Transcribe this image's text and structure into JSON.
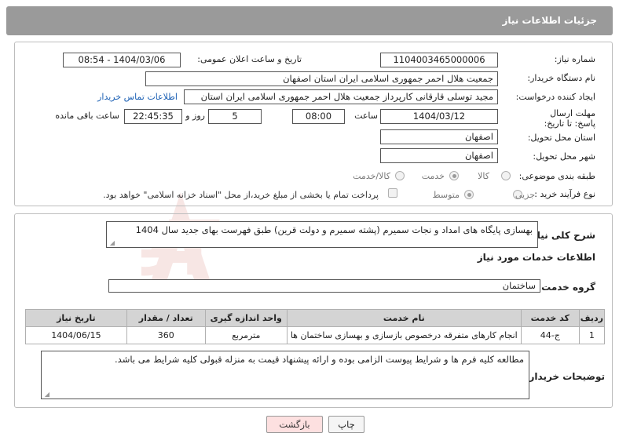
{
  "header": {
    "title": "جزئیات اطلاعات نیاز"
  },
  "fields": {
    "need_number_label": "شماره نیاز:",
    "need_number": "1104003465000006",
    "announce_label": "تاریخ و ساعت اعلان عمومی:",
    "announce_value": "1404/03/06 - 08:54",
    "buyer_org_label": "نام دستگاه خریدار:",
    "buyer_org": "جمعیت هلال احمر جمهوری اسلامی ایران استان اصفهان",
    "creator_label": "ایجاد کننده درخواست:",
    "creator": "مجید توسلی قارقانی کارپرداز جمعیت هلال احمر جمهوری اسلامی ایران استان",
    "contact_link": "اطلاعات تماس خریدار",
    "deadline_label": "مهلت ارسال پاسخ: تا تاریخ:",
    "deadline_date": "1404/03/12",
    "time_label": "ساعت",
    "deadline_time": "08:00",
    "days_value": "5",
    "days_label": "روز و",
    "remaining_time": "22:45:35",
    "remaining_label": "ساعت باقی مانده",
    "province_label": "استان محل تحویل:",
    "province": "اصفهان",
    "city_label": "شهر محل تحویل:",
    "city": "اصفهان",
    "category_label": "طبقه بندی موضوعی:",
    "category_options": [
      "کالا",
      "خدمت",
      "کالا/خدمت"
    ],
    "category_selected": "خدمت",
    "process_label": "نوع فرآیند خرید :",
    "process_options": [
      "جزیی",
      "متوسط"
    ],
    "process_selected": "متوسط",
    "treasury_text": "پرداخت تمام یا بخشی از مبلغ خرید،از محل \"اسناد خزانه اسلامی\" خواهد بود."
  },
  "description": {
    "label": "شرح کلی نیاز:",
    "value": "بهسازی پایگاه های امداد و نجات سمیرم (پشته سمیرم و دولت قرین) طبق فهرست بهای جدید سال 1404"
  },
  "services": {
    "section_title": "اطلاعات خدمات مورد نیاز",
    "group_label": "گروه خدمت:",
    "group_value": "ساختمان",
    "columns": [
      "ردیف",
      "کد خدمت",
      "نام خدمت",
      "واحد اندازه گیری",
      "تعداد / مقدار",
      "تاریخ نیاز"
    ],
    "rows": [
      [
        "1",
        "ج-44",
        "انجام کارهای متفرقه درخصوص بازسازی و بهسازی ساختمان ها",
        "مترمربع",
        "360",
        "1404/06/15"
      ]
    ]
  },
  "buyer_notes": {
    "label": "توضیحات خریدار:",
    "value": "مطالعه کلیه فرم ها و شرایط  پیوست الزامی بوده و ارائه پیشنهاد قیمت به منزله قبولی کلیه شرایط می باشد."
  },
  "buttons": {
    "print": "چاپ",
    "back": "بازگشت"
  },
  "watermark": {
    "text": "AriaTender.neT"
  },
  "colors": {
    "header_bg": "#9a9a9a",
    "link": "#1a5fb4",
    "back_button": "#fde0e0",
    "watermark": "#c0392b"
  }
}
